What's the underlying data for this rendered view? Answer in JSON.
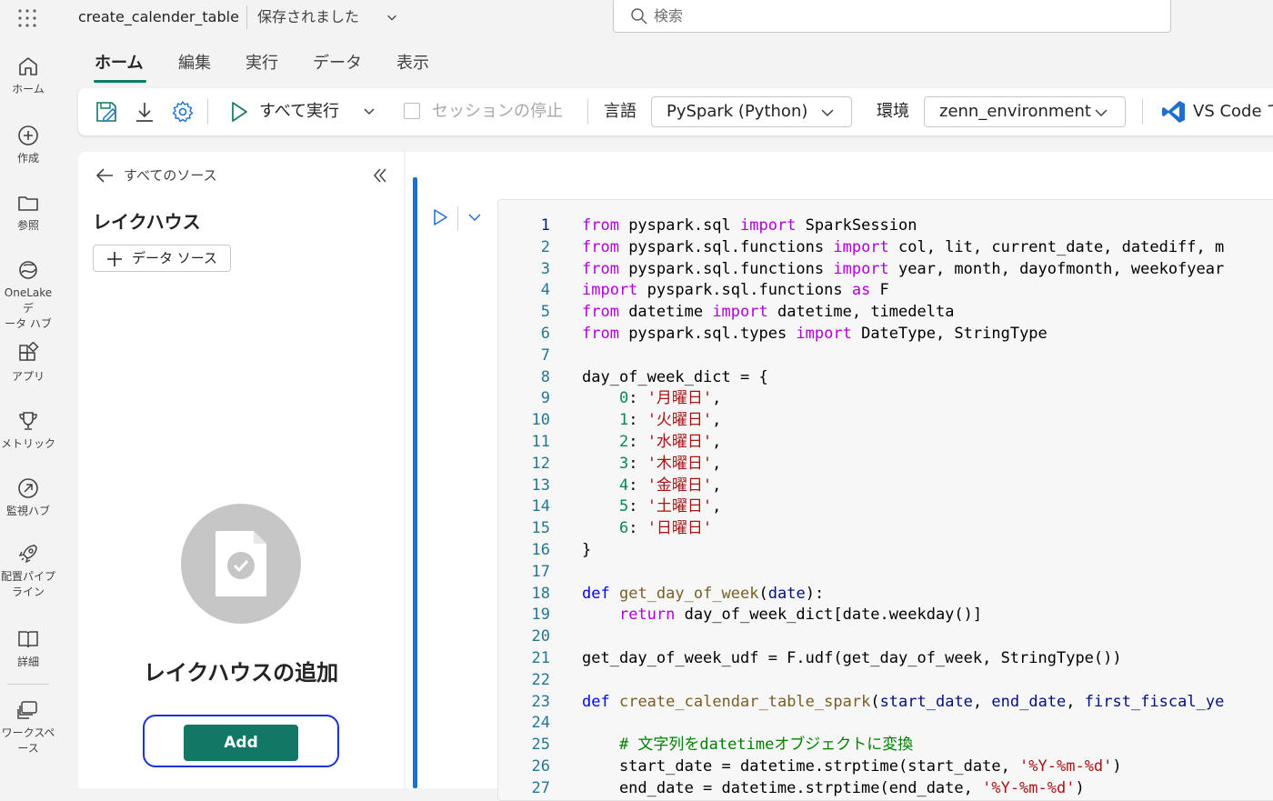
{
  "header": {
    "file_title": "create_calender_table",
    "save_status": "保存されました",
    "search_placeholder": "検索"
  },
  "nav": {
    "items": [
      {
        "label": "ホーム",
        "icon": "home-icon"
      },
      {
        "label": "作成",
        "icon": "create-icon"
      },
      {
        "label": "参照",
        "icon": "folder-icon"
      },
      {
        "label": "OneLake デ\nータ ハブ",
        "icon": "onelake-icon"
      },
      {
        "label": "アプリ",
        "icon": "apps-icon"
      },
      {
        "label": "メトリック",
        "icon": "trophy-icon"
      },
      {
        "label": "監視ハブ",
        "icon": "monitor-icon"
      },
      {
        "label": "配置パイプ\nライン",
        "icon": "rocket-icon"
      },
      {
        "label": "詳細",
        "icon": "book-icon"
      },
      {
        "label": "ワークスペ\nース",
        "icon": "workspace-icon"
      }
    ]
  },
  "ribbon": {
    "tabs": [
      "ホーム",
      "編集",
      "実行",
      "データ",
      "表示"
    ],
    "active_tab": "ホーム",
    "run_all": "すべて実行",
    "stop_session": "セッションの停止",
    "language_label": "言語",
    "language_value": "PySpark (Python)",
    "environment_label": "環境",
    "environment_value": "zenn_environment",
    "vscode_label": "VS Code で"
  },
  "explorer": {
    "back_label": "すべてのソース",
    "section_title": "レイクハウス",
    "add_source_label": "データ ソース",
    "empty_title": "レイクハウスの追加",
    "add_button": "Add"
  },
  "colors": {
    "accent": "#117865",
    "cell_bar": "#1f6fd1",
    "focus_ring": "#1a33d6",
    "vscode_blue": "#1f6fd1"
  },
  "code": {
    "current_line": 1,
    "lines": [
      [
        [
          "k",
          "from"
        ],
        [
          "t",
          " pyspark.sql "
        ],
        [
          "k",
          "import"
        ],
        [
          "t",
          " SparkSession"
        ]
      ],
      [
        [
          "k",
          "from"
        ],
        [
          "t",
          " pyspark.sql.functions "
        ],
        [
          "k",
          "import"
        ],
        [
          "t",
          " col, lit, current_date, datediff, m"
        ]
      ],
      [
        [
          "k",
          "from"
        ],
        [
          "t",
          " pyspark.sql.functions "
        ],
        [
          "k",
          "import"
        ],
        [
          "t",
          " year, month, dayofmonth, weekofyear"
        ]
      ],
      [
        [
          "k",
          "import"
        ],
        [
          "t",
          " pyspark.sql.functions "
        ],
        [
          "k",
          "as"
        ],
        [
          "t",
          " F"
        ]
      ],
      [
        [
          "k",
          "from"
        ],
        [
          "t",
          " datetime "
        ],
        [
          "k",
          "import"
        ],
        [
          "t",
          " datetime, timedelta"
        ]
      ],
      [
        [
          "k",
          "from"
        ],
        [
          "t",
          " pyspark.sql.types "
        ],
        [
          "k",
          "import"
        ],
        [
          "t",
          " DateType, StringType"
        ]
      ],
      [],
      [
        [
          "t",
          "day_of_week_dict = {"
        ]
      ],
      [
        [
          "t",
          "    "
        ],
        [
          "n",
          "0"
        ],
        [
          "t",
          ": "
        ],
        [
          "s",
          "'月曜日'"
        ],
        [
          "t",
          ","
        ]
      ],
      [
        [
          "t",
          "    "
        ],
        [
          "n",
          "1"
        ],
        [
          "t",
          ": "
        ],
        [
          "s",
          "'火曜日'"
        ],
        [
          "t",
          ","
        ]
      ],
      [
        [
          "t",
          "    "
        ],
        [
          "n",
          "2"
        ],
        [
          "t",
          ": "
        ],
        [
          "s",
          "'水曜日'"
        ],
        [
          "t",
          ","
        ]
      ],
      [
        [
          "t",
          "    "
        ],
        [
          "n",
          "3"
        ],
        [
          "t",
          ": "
        ],
        [
          "s",
          "'木曜日'"
        ],
        [
          "t",
          ","
        ]
      ],
      [
        [
          "t",
          "    "
        ],
        [
          "n",
          "4"
        ],
        [
          "t",
          ": "
        ],
        [
          "s",
          "'金曜日'"
        ],
        [
          "t",
          ","
        ]
      ],
      [
        [
          "t",
          "    "
        ],
        [
          "n",
          "5"
        ],
        [
          "t",
          ": "
        ],
        [
          "s",
          "'土曜日'"
        ],
        [
          "t",
          ","
        ]
      ],
      [
        [
          "t",
          "    "
        ],
        [
          "n",
          "6"
        ],
        [
          "t",
          ": "
        ],
        [
          "s",
          "'日曜日'"
        ]
      ],
      [
        [
          "t",
          "}"
        ]
      ],
      [],
      [
        [
          "kb",
          "def"
        ],
        [
          "t",
          " "
        ],
        [
          "f",
          "get_day_of_week"
        ],
        [
          "t",
          "("
        ],
        [
          "p",
          "date"
        ],
        [
          "t",
          "):"
        ]
      ],
      [
        [
          "t",
          "    "
        ],
        [
          "k",
          "return"
        ],
        [
          "t",
          " day_of_week_dict[date.weekday()]"
        ]
      ],
      [],
      [
        [
          "t",
          "get_day_of_week_udf = F.udf(get_day_of_week, StringType())"
        ]
      ],
      [],
      [
        [
          "kb",
          "def"
        ],
        [
          "t",
          " "
        ],
        [
          "f",
          "create_calendar_table_spark"
        ],
        [
          "t",
          "("
        ],
        [
          "p",
          "start_date"
        ],
        [
          "t",
          ", "
        ],
        [
          "p",
          "end_date"
        ],
        [
          "t",
          ", "
        ],
        [
          "p",
          "first_fiscal_ye"
        ]
      ],
      [],
      [
        [
          "t",
          "    "
        ],
        [
          "c",
          "# 文字列をdatetimeオブジェクトに変換"
        ]
      ],
      [
        [
          "t",
          "    start_date = datetime.strptime(start_date, "
        ],
        [
          "s",
          "'%Y-%m-%d'"
        ],
        [
          "t",
          ")"
        ]
      ],
      [
        [
          "t",
          "    end_date = datetime.strptime(end_date, "
        ],
        [
          "s",
          "'%Y-%m-%d'"
        ],
        [
          "t",
          ")"
        ]
      ]
    ]
  }
}
